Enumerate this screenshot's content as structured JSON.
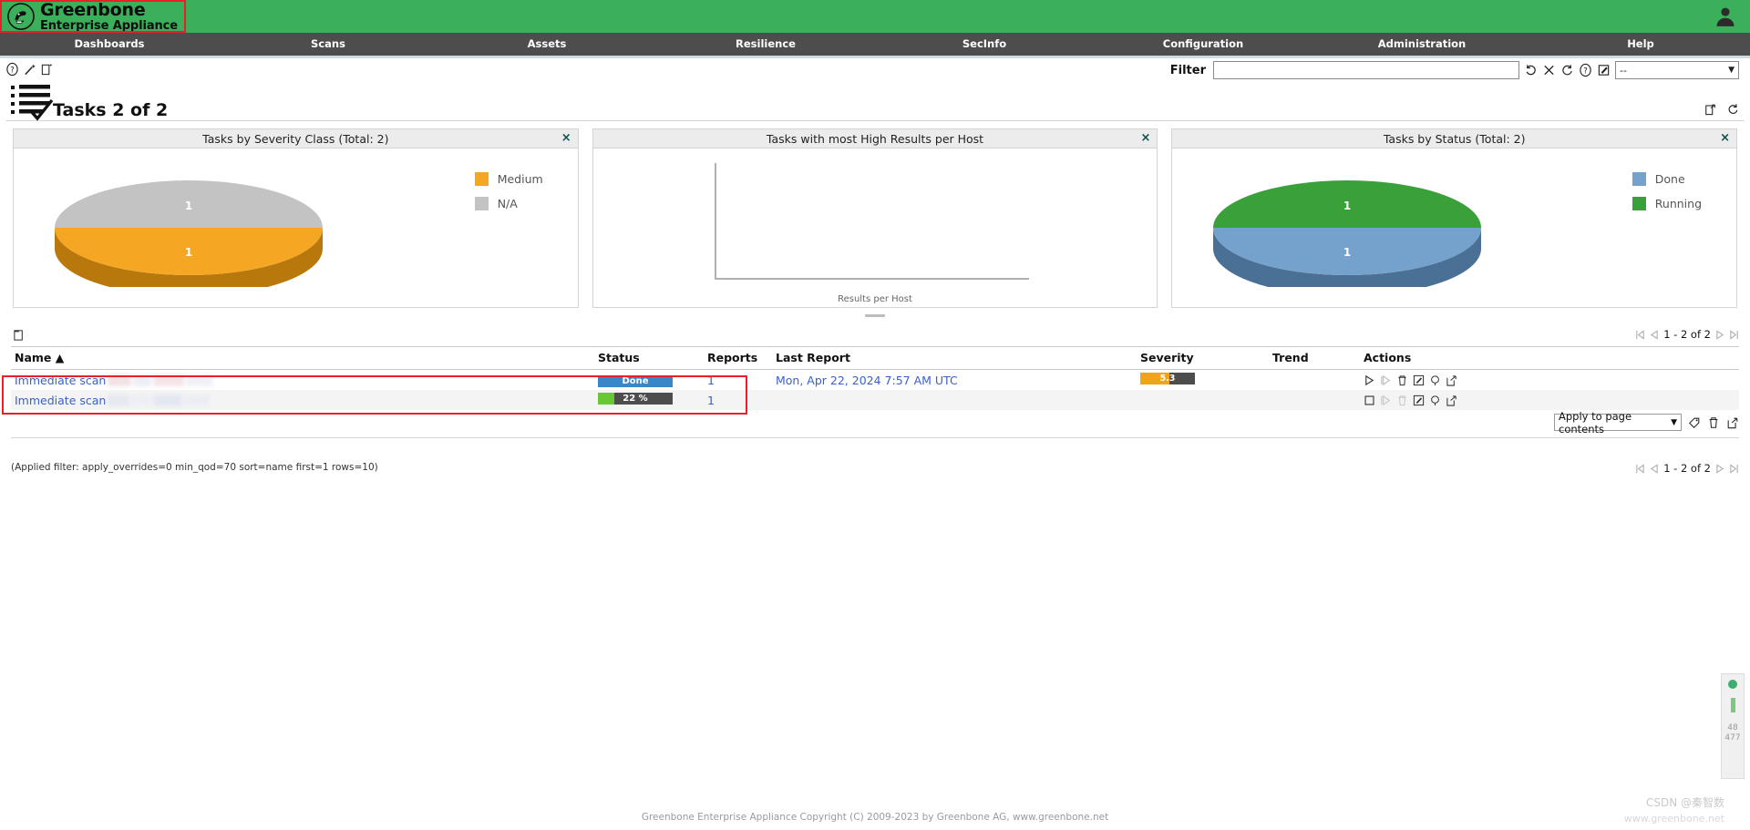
{
  "brand": {
    "title": "Greenbone",
    "subtitle": "Enterprise Appliance",
    "logo_icon": "greenbone-dragon-logo",
    "header_color": "#3caf5a",
    "annotation_color": "#e8202a"
  },
  "user_menu": {
    "icon": "user-account-icon"
  },
  "nav": {
    "items": [
      {
        "label": "Dashboards"
      },
      {
        "label": "Scans"
      },
      {
        "label": "Assets"
      },
      {
        "label": "Resilience"
      },
      {
        "label": "SecInfo"
      },
      {
        "label": "Configuration"
      },
      {
        "label": "Administration"
      },
      {
        "label": "Help"
      }
    ]
  },
  "toolbar": {
    "icons": [
      {
        "name": "help-icon"
      },
      {
        "name": "wizard-wand-icon"
      },
      {
        "name": "new-task-icon"
      }
    ]
  },
  "filter": {
    "label": "Filter",
    "value": "",
    "placeholder": "",
    "icons": [
      {
        "name": "update-filter-icon"
      },
      {
        "name": "remove-filter-icon"
      },
      {
        "name": "reset-filter-icon"
      },
      {
        "name": "help-filter-icon"
      },
      {
        "name": "edit-filter-icon"
      }
    ],
    "select_value": "--"
  },
  "page": {
    "title": "Tasks 2 of 2",
    "list_icon": "task-list-icon",
    "actions": [
      {
        "name": "export-page-icon"
      },
      {
        "name": "refresh-page-icon"
      }
    ]
  },
  "dashboards": [
    {
      "title": "Tasks by Severity Class (Total: 2)",
      "close_icon": "close-icon",
      "chart_kind": "pie3d"
    },
    {
      "title": "Tasks with most High Results per Host",
      "close_icon": "close-icon",
      "chart_kind": "bar-empty"
    },
    {
      "title": "Tasks by Status (Total: 2)",
      "close_icon": "close-icon",
      "chart_kind": "pie3d"
    }
  ],
  "chart_data": [
    {
      "type": "pie",
      "title": "Tasks by Severity Class (Total: 2)",
      "total": 2,
      "categories": [
        "N/A",
        "Medium"
      ],
      "values": [
        1,
        1
      ],
      "data_labels": [
        "1",
        "1"
      ],
      "colors": [
        "#c3c3c3",
        "#f5a623"
      ],
      "legend": [
        {
          "label": "Medium",
          "color": "#f5a623"
        },
        {
          "label": "N/A",
          "color": "#c3c3c3"
        }
      ],
      "legend_position": "right",
      "three_d": true
    },
    {
      "type": "bar",
      "title": "Tasks with most High Results per Host",
      "categories": [],
      "values": [],
      "xlabel": "Results per Host",
      "ylabel": "",
      "grid": false,
      "empty": true
    },
    {
      "type": "pie",
      "title": "Tasks by Status (Total: 2)",
      "total": 2,
      "categories": [
        "Running",
        "Done"
      ],
      "values": [
        1,
        1
      ],
      "data_labels": [
        "1",
        "1"
      ],
      "colors": [
        "#3aa03a",
        "#74a2cc"
      ],
      "legend": [
        {
          "label": "Done",
          "color": "#74a2cc"
        },
        {
          "label": "Running",
          "color": "#3aa03a"
        }
      ],
      "legend_position": "right",
      "three_d": true
    }
  ],
  "table": {
    "folder_icon": "folder-icon",
    "columns": [
      {
        "label": "Name",
        "sort": "▲"
      },
      {
        "label": "Status"
      },
      {
        "label": "Reports"
      },
      {
        "label": "Last Report"
      },
      {
        "label": "Severity"
      },
      {
        "label": "Trend"
      },
      {
        "label": "Actions"
      }
    ],
    "rows": [
      {
        "name": "Immediate scan",
        "status_label": "Done",
        "status_type": "done",
        "status_percent": 100,
        "reports": "1",
        "last_report": "Mon, Apr 22, 2024 7:57 AM UTC",
        "severity": "5.3 (Medium)",
        "severity_percent": 53,
        "trend": "",
        "actions": [
          {
            "name": "start-task-icon",
            "disabled": false
          },
          {
            "name": "resume-task-icon",
            "disabled": true
          },
          {
            "name": "delete-task-icon",
            "disabled": false
          },
          {
            "name": "edit-task-icon",
            "disabled": false
          },
          {
            "name": "clone-task-icon",
            "disabled": false
          },
          {
            "name": "export-task-icon",
            "disabled": false
          }
        ]
      },
      {
        "name": "Immediate scan",
        "status_label": "22 %",
        "status_type": "running",
        "status_percent": 22,
        "reports": "1",
        "last_report": "",
        "severity": "",
        "severity_percent": 0,
        "trend": "",
        "actions": [
          {
            "name": "stop-task-icon",
            "disabled": false
          },
          {
            "name": "resume-task-icon",
            "disabled": true
          },
          {
            "name": "delete-task-icon",
            "disabled": true
          },
          {
            "name": "edit-task-icon",
            "disabled": false
          },
          {
            "name": "clone-task-icon",
            "disabled": false
          },
          {
            "name": "export-task-icon",
            "disabled": false
          }
        ]
      }
    ]
  },
  "pagination": {
    "range": "1 - 2 of 2",
    "first_icon": "first-page-icon",
    "prev_icon": "previous-page-icon",
    "next_icon": "next-page-icon",
    "last_icon": "last-page-icon"
  },
  "bulk": {
    "select_value": "Apply to page contents",
    "icons": [
      {
        "name": "add-tag-icon"
      },
      {
        "name": "delete-selected-icon"
      },
      {
        "name": "export-selected-icon"
      }
    ]
  },
  "applied_filter": "(Applied filter: apply_overrides=0 min_qod=70 sort=name first=1 rows=10)",
  "footer": {
    "text": "Greenbone Enterprise Appliance Copyright (C) 2009-2023 by Greenbone AG, www.greenbone.net"
  },
  "watermark": {
    "line1": "CSDN @秦智数",
    "line2": "www.greenbone.net"
  },
  "scroll_widget": {
    "value_top": "48",
    "value_bottom": "477"
  }
}
